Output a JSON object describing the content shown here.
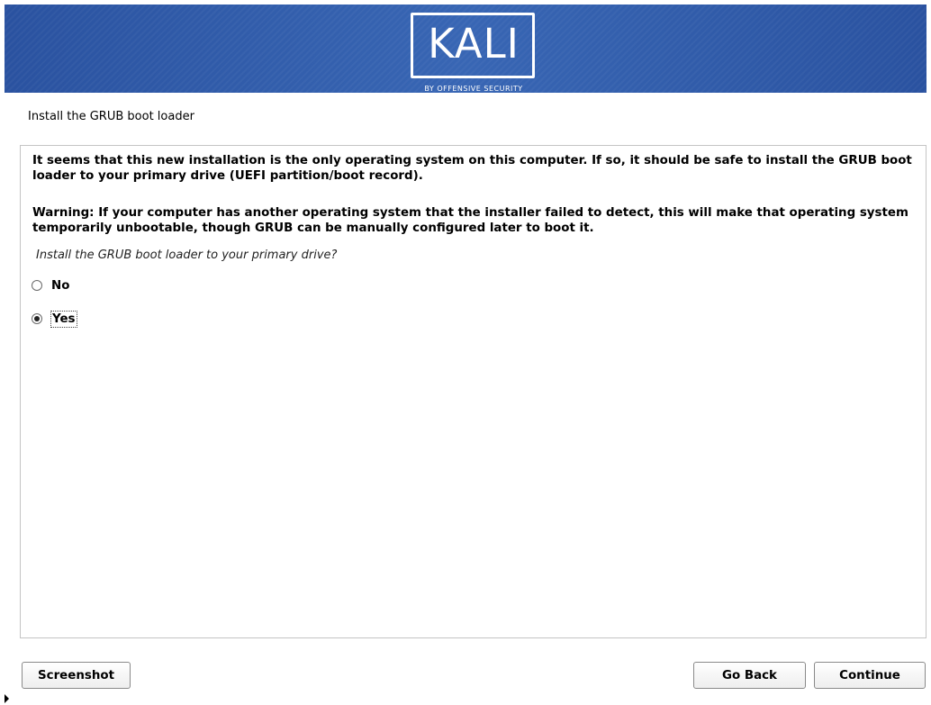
{
  "header": {
    "logo_text": "KALI",
    "logo_subtitle": "BY OFFENSIVE SECURITY"
  },
  "page": {
    "title": "Install the GRUB boot loader"
  },
  "content": {
    "paragraph1": "It seems that this new installation is the only operating system on this computer. If so, it should be safe to install the GRUB boot loader to your primary drive (UEFI partition/boot record).",
    "paragraph2": "Warning: If your computer has another operating system that the installer failed to detect, this will make that operating system temporarily unbootable, though GRUB can be manually configured later to boot it.",
    "question": "Install the GRUB boot loader to your primary drive?",
    "options": [
      {
        "label": "No",
        "selected": false
      },
      {
        "label": "Yes",
        "selected": true
      }
    ]
  },
  "buttons": {
    "screenshot": "Screenshot",
    "go_back": "Go Back",
    "continue": "Continue"
  },
  "colors": {
    "banner": "#2d57a5"
  }
}
